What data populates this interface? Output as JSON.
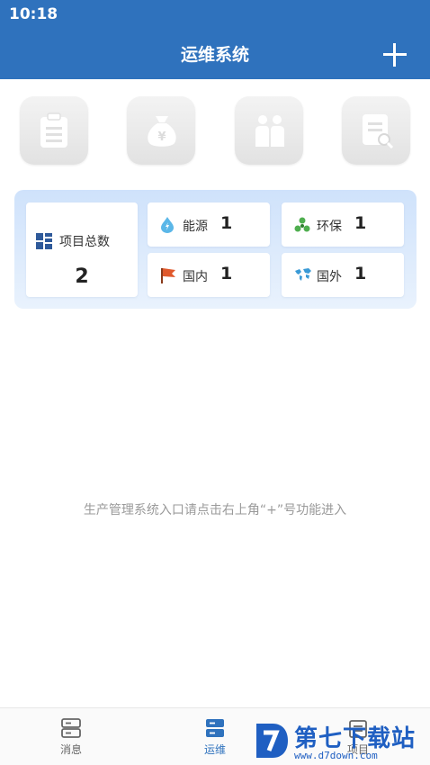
{
  "status_bar": {
    "time": "10:18"
  },
  "header": {
    "title": "运维系统",
    "add_icon": "plus-icon"
  },
  "shortcuts": [
    {
      "icon": "clipboard-icon"
    },
    {
      "icon": "money-bag-icon"
    },
    {
      "icon": "team-icon"
    },
    {
      "icon": "document-search-icon"
    }
  ],
  "stats": {
    "total": {
      "label": "项目总数",
      "value": "2",
      "icon": "grid-icon"
    },
    "energy": {
      "label": "能源",
      "value": "1",
      "icon": "water-drop-icon"
    },
    "environment": {
      "label": "环保",
      "value": "1",
      "icon": "recycle-icon"
    },
    "domestic": {
      "label": "国内",
      "value": "1",
      "icon": "flag-icon"
    },
    "overseas": {
      "label": "国外",
      "value": "1",
      "icon": "world-map-icon"
    }
  },
  "hint": "生产管理系统入口请点击右上角“+”号功能进入",
  "tabbar": {
    "tabs": [
      {
        "label": "消息",
        "icon": "message-icon",
        "active": false
      },
      {
        "label": "运维",
        "icon": "ops-icon",
        "active": true
      },
      {
        "label": "项目",
        "icon": "project-icon",
        "active": false
      }
    ]
  },
  "watermark": {
    "title": "第七下载站",
    "url": "www.d7down.com"
  },
  "colors": {
    "primary": "#2f72bd",
    "panel_bg": "#dcebfc",
    "hint": "#9a9a9a"
  }
}
